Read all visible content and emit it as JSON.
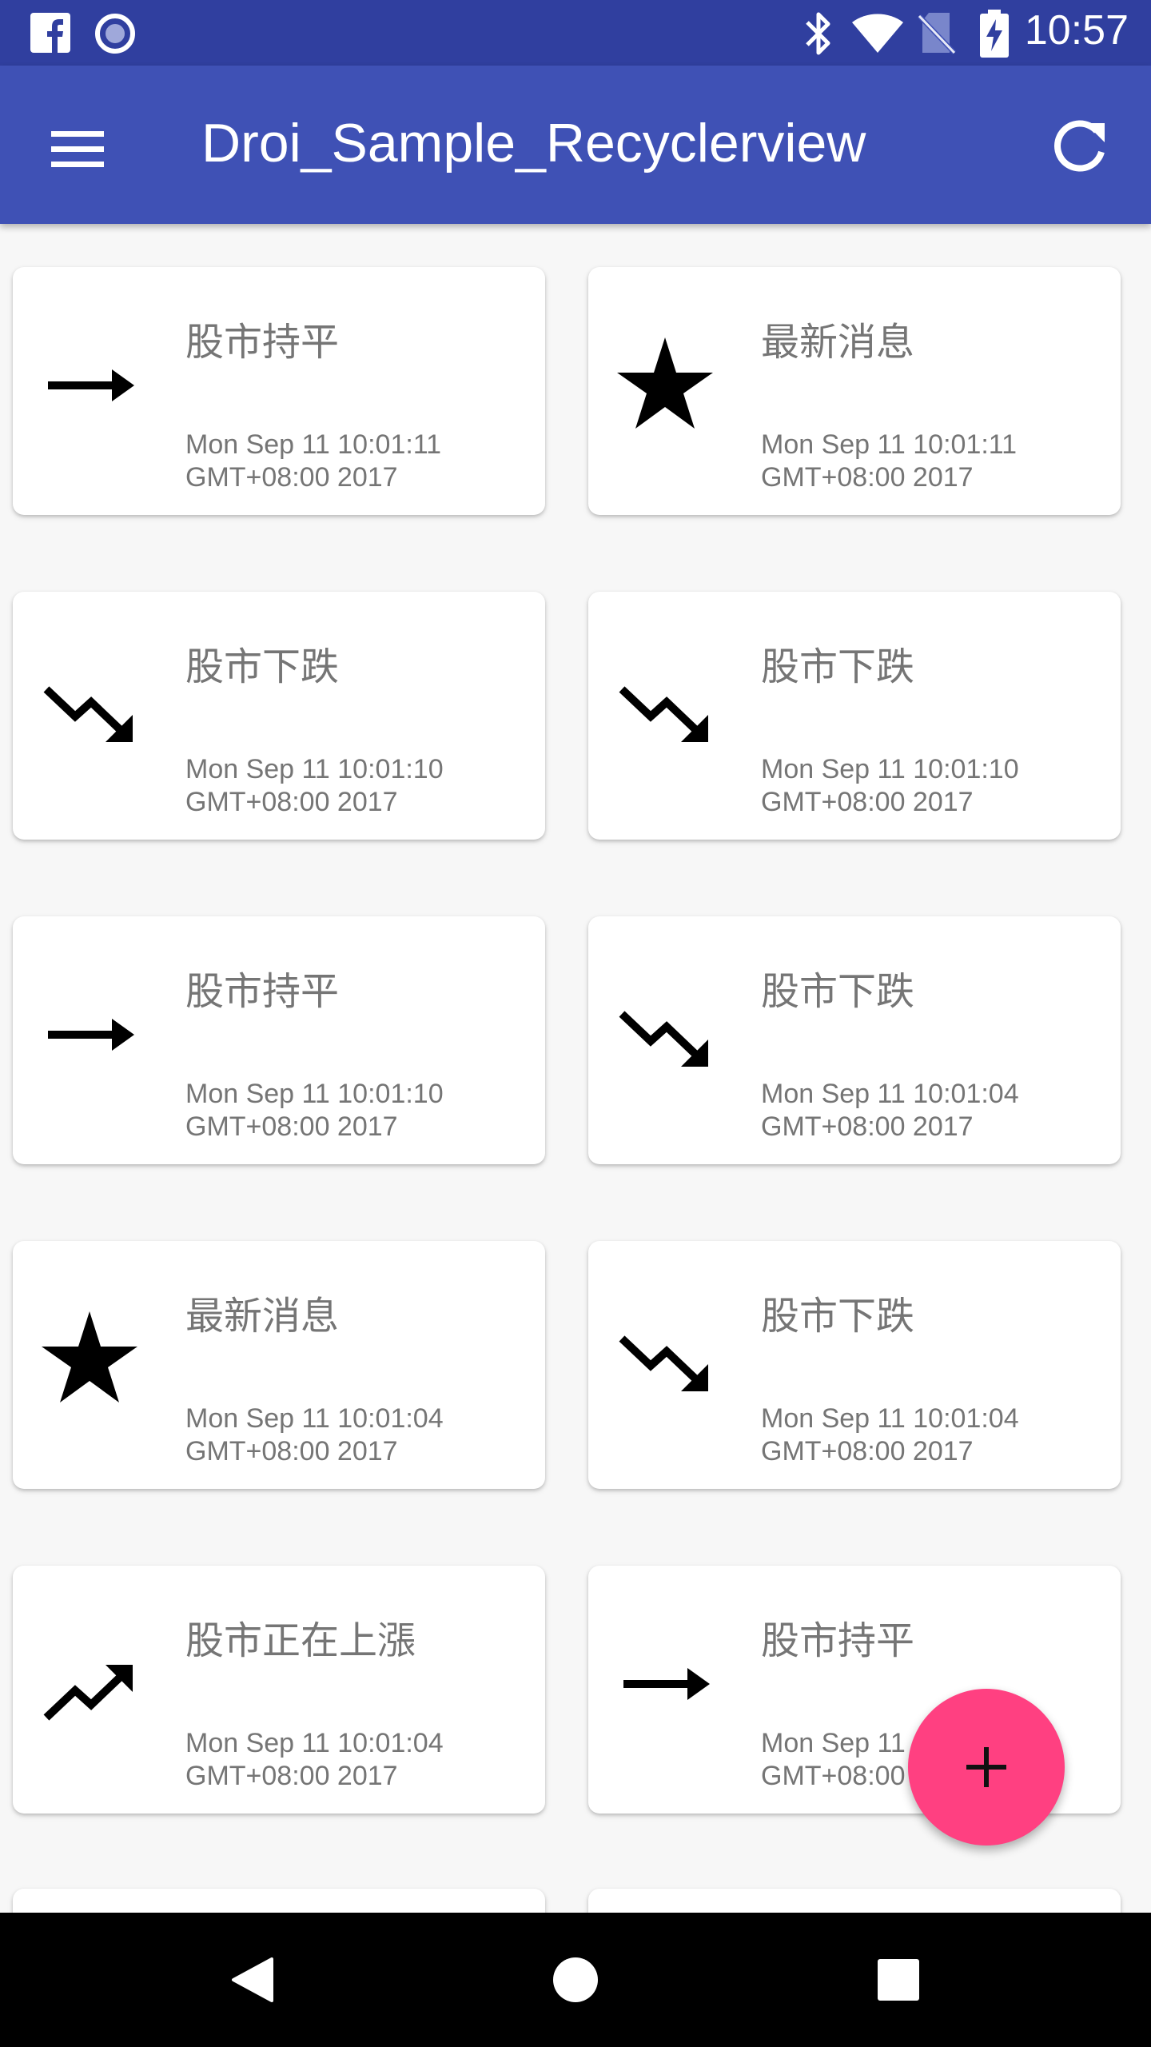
{
  "status_bar": {
    "time": "10:57",
    "left_icons": [
      "facebook-icon",
      "record-icon"
    ],
    "right_icons": [
      "bluetooth-icon",
      "wifi-icon",
      "no-sim-icon",
      "battery-charging-icon"
    ]
  },
  "toolbar": {
    "title": "Droi_Sample_Recyclerview",
    "menu_icon": "menu-icon",
    "refresh_icon": "refresh-icon",
    "background": "#3f51b5",
    "status_bar_color": "#303f9f"
  },
  "cards": [
    {
      "icon": "arrow-flat-icon",
      "title": "股市持平",
      "time_line1": "Mon Sep 11 10:01:11",
      "time_line2": "GMT+08:00 2017"
    },
    {
      "icon": "star-icon",
      "title": "最新消息",
      "time_line1": "Mon Sep 11 10:01:11",
      "time_line2": "GMT+08:00 2017"
    },
    {
      "icon": "trending-down-icon",
      "title": "股市下跌",
      "time_line1": "Mon Sep 11 10:01:10",
      "time_line2": "GMT+08:00 2017"
    },
    {
      "icon": "trending-down-icon",
      "title": "股市下跌",
      "time_line1": "Mon Sep 11 10:01:10",
      "time_line2": "GMT+08:00 2017"
    },
    {
      "icon": "arrow-flat-icon",
      "title": "股市持平",
      "time_line1": "Mon Sep 11 10:01:10",
      "time_line2": "GMT+08:00 2017"
    },
    {
      "icon": "trending-down-icon",
      "title": "股市下跌",
      "time_line1": "Mon Sep 11 10:01:04",
      "time_line2": "GMT+08:00 2017"
    },
    {
      "icon": "star-icon",
      "title": "最新消息",
      "time_line1": "Mon Sep 11 10:01:04",
      "time_line2": "GMT+08:00 2017"
    },
    {
      "icon": "trending-down-icon",
      "title": "股市下跌",
      "time_line1": "Mon Sep 11 10:01:04",
      "time_line2": "GMT+08:00 2017"
    },
    {
      "icon": "trending-up-icon",
      "title": "股市正在上漲",
      "time_line1": "Mon Sep 11 10:01:04",
      "time_line2": "GMT+08:00 2017"
    },
    {
      "icon": "arrow-flat-icon",
      "title": "股市持平",
      "time_line1": "Mon Sep 11",
      "time_line2": "GMT+08:00"
    }
  ],
  "fab": {
    "icon": "add-icon",
    "color": "#ff4081"
  },
  "nav_bar": {
    "icons": [
      "back-icon",
      "home-icon",
      "recents-icon"
    ]
  }
}
